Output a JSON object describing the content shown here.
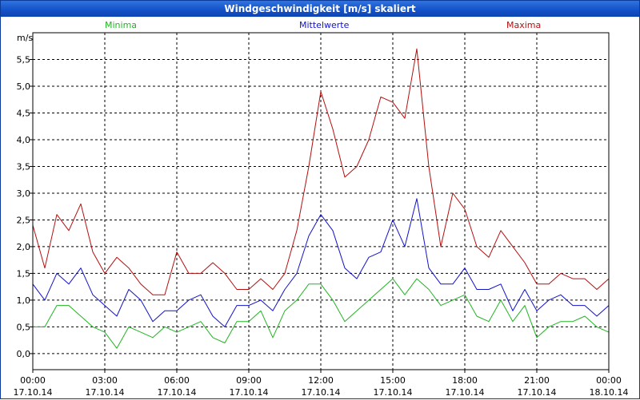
{
  "window": {
    "title": "Windgeschwindigkeit [m/s] skaliert"
  },
  "colors": {
    "minima": "#22b422",
    "mittel": "#1212c8",
    "maxima": "#b40f0f",
    "grid": "#000000"
  },
  "chart_data": {
    "type": "line",
    "title": "Windgeschwindigkeit [m/s] skaliert",
    "ylabel": "m/s",
    "xlabel": "",
    "ylim": [
      -0.3,
      6.0
    ],
    "xlim": [
      0,
      24
    ],
    "grid": true,
    "legend": "top",
    "yticks": [
      "0,0",
      "0,5",
      "1,0",
      "1,5",
      "2,0",
      "2,5",
      "3,0",
      "3,5",
      "4,0",
      "4,5",
      "5,0",
      "5,5"
    ],
    "ytick_values": [
      0,
      0.5,
      1.0,
      1.5,
      2.0,
      2.5,
      3.0,
      3.5,
      4.0,
      4.5,
      5.0,
      5.5
    ],
    "xtick_values": [
      0,
      3,
      6,
      9,
      12,
      15,
      18,
      21,
      24
    ],
    "xticks": [
      {
        "time": "00:00",
        "date": "17.10.14"
      },
      {
        "time": "03:00",
        "date": "17.10.14"
      },
      {
        "time": "06:00",
        "date": "17.10.14"
      },
      {
        "time": "09:00",
        "date": "17.10.14"
      },
      {
        "time": "12:00",
        "date": "17.10.14"
      },
      {
        "time": "15:00",
        "date": "17.10.14"
      },
      {
        "time": "18:00",
        "date": "17.10.14"
      },
      {
        "time": "21:00",
        "date": "17.10.14"
      },
      {
        "time": "00:00",
        "date": "18.10.14"
      }
    ],
    "x": [
      0,
      0.5,
      1,
      1.5,
      2,
      2.5,
      3,
      3.5,
      4,
      4.5,
      5,
      5.5,
      6,
      6.5,
      7,
      7.5,
      8,
      8.5,
      9,
      9.5,
      10,
      10.5,
      11,
      11.5,
      12,
      12.5,
      13,
      13.5,
      14,
      14.5,
      15,
      15.5,
      16,
      16.5,
      17,
      17.5,
      18,
      18.5,
      19,
      19.5,
      20,
      20.5,
      21,
      21.5,
      22,
      22.5,
      23,
      23.5,
      24
    ],
    "series": [
      {
        "name": "Minima",
        "color": "#22b422",
        "values": [
          0.5,
          0.5,
          0.9,
          0.9,
          0.7,
          0.5,
          0.4,
          0.1,
          0.5,
          0.4,
          0.3,
          0.5,
          0.4,
          0.5,
          0.6,
          0.3,
          0.2,
          0.6,
          0.6,
          0.8,
          0.3,
          0.8,
          1.0,
          1.3,
          1.3,
          1.0,
          0.6,
          0.8,
          1.0,
          1.2,
          1.4,
          1.1,
          1.4,
          1.2,
          0.9,
          1.0,
          1.1,
          0.7,
          0.6,
          1.0,
          0.6,
          0.9,
          0.3,
          0.5,
          0.6,
          0.6,
          0.7,
          0.5,
          0.4
        ]
      },
      {
        "name": "Mittelwerte",
        "color": "#1212c8",
        "values": [
          1.3,
          1.0,
          1.5,
          1.3,
          1.6,
          1.1,
          0.9,
          0.7,
          1.2,
          1.0,
          0.6,
          0.8,
          0.8,
          1.0,
          1.1,
          0.7,
          0.5,
          0.9,
          0.9,
          1.0,
          0.8,
          1.2,
          1.5,
          2.2,
          2.6,
          2.3,
          1.6,
          1.4,
          1.8,
          1.9,
          2.5,
          2.0,
          2.9,
          1.6,
          1.3,
          1.3,
          1.6,
          1.2,
          1.2,
          1.3,
          0.8,
          1.2,
          0.8,
          1.0,
          1.1,
          0.9,
          0.9,
          0.7,
          0.9
        ]
      },
      {
        "name": "Maxima",
        "color": "#b40f0f",
        "values": [
          2.4,
          1.6,
          2.6,
          2.3,
          2.8,
          1.9,
          1.5,
          1.8,
          1.6,
          1.3,
          1.1,
          1.1,
          1.9,
          1.5,
          1.5,
          1.7,
          1.5,
          1.2,
          1.2,
          1.4,
          1.2,
          1.5,
          2.3,
          3.5,
          4.9,
          4.2,
          3.3,
          3.5,
          4.0,
          4.8,
          4.7,
          4.4,
          5.7,
          3.5,
          2.0,
          3.0,
          2.7,
          2.0,
          1.8,
          2.3,
          2.0,
          1.7,
          1.3,
          1.3,
          1.5,
          1.4,
          1.4,
          1.2,
          1.4
        ]
      }
    ]
  }
}
